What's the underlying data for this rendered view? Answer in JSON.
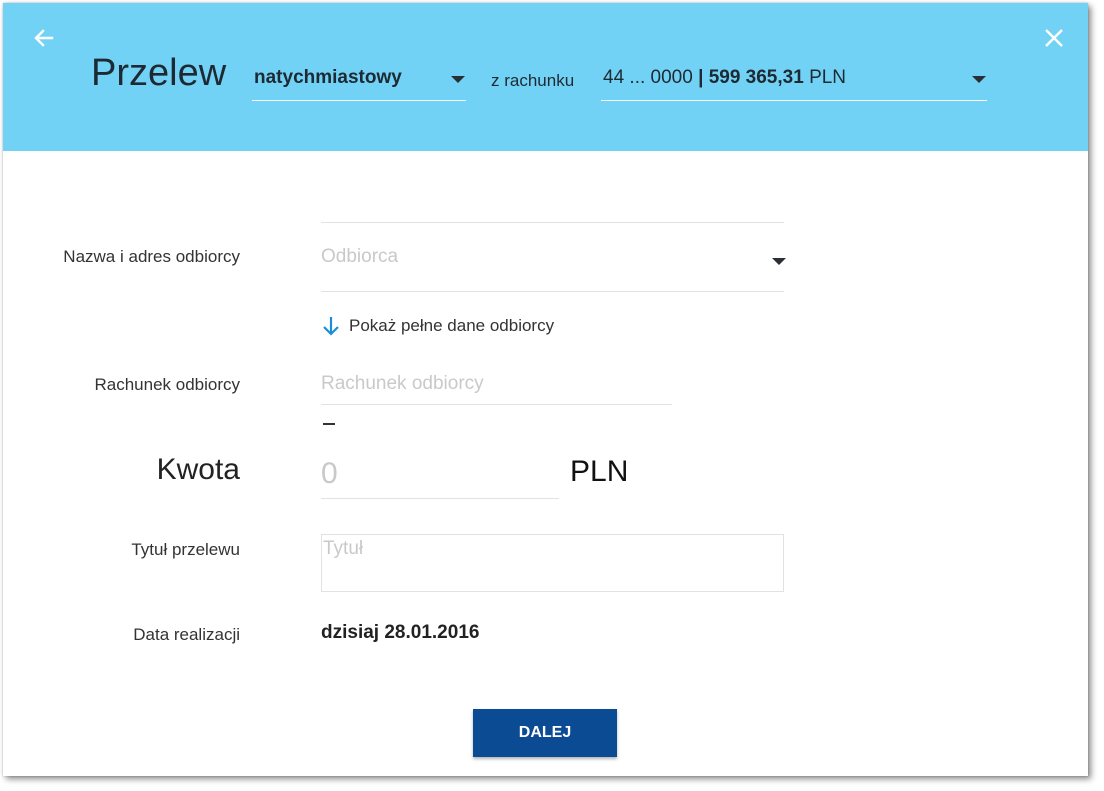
{
  "header": {
    "title": "Przelew",
    "transfer_type": "natychmiastowy",
    "from_label": "z rachunku",
    "account_number": "44 ... 0000",
    "separator": "|",
    "account_balance": "599 365,31",
    "account_currency": "PLN",
    "back_icon": "arrow-left-icon",
    "close_icon": "close-icon"
  },
  "form": {
    "recipient": {
      "label": "Nazwa i adres odbiorcy",
      "placeholder": "Odbiorca",
      "show_full_link": "Pokaż pełne dane odbiorcy",
      "link_icon": "arrow-down-icon"
    },
    "account": {
      "label": "Rachunek odbiorcy",
      "placeholder": "Rachunek odbiorcy"
    },
    "amount": {
      "label": "Kwota",
      "placeholder": "0",
      "currency": "PLN"
    },
    "transfer_title": {
      "label": "Tytuł przelewu",
      "placeholder": "Tytuł"
    },
    "execution_date": {
      "label": "Data realizacji",
      "value": "dzisiaj 28.01.2016"
    }
  },
  "actions": {
    "next_label": "DALEJ"
  },
  "colors": {
    "header_bg": "#72d2f5",
    "primary_button": "#0a4b94",
    "link_icon": "#1a8ed8"
  }
}
